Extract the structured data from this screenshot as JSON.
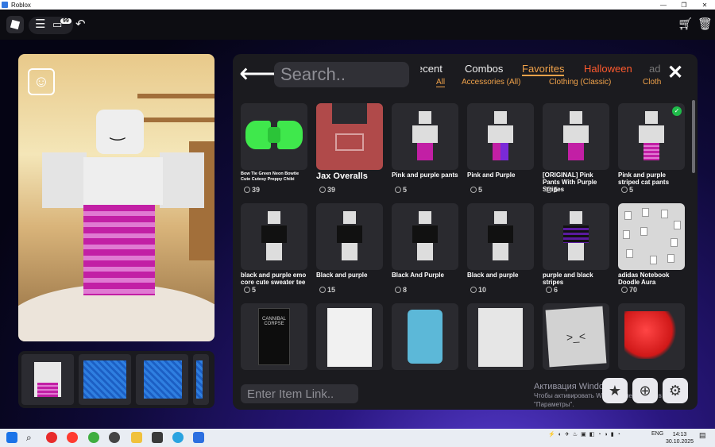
{
  "window": {
    "title": "Roblox",
    "controls": [
      "—",
      "❐",
      "✕"
    ]
  },
  "topbar": {
    "chat_badge": "99"
  },
  "catalog": {
    "search": {
      "placeholder": "Search.."
    },
    "tabs": [
      "ecent",
      "Combos",
      "Favorites",
      "Halloween",
      "ad"
    ],
    "active_tab": "Favorites",
    "subtabs": [
      "All",
      "Accessories (All)",
      "Clothing (Classic)",
      "Cloth"
    ],
    "active_subtab": "All",
    "link_input": {
      "placeholder": "Enter Item Link.."
    },
    "items": [
      {
        "name": "Bow Tie Green Neon Bowtie Cute Cutesy Preppy Chibi",
        "price": "39",
        "thumb": "bow"
      },
      {
        "name": "Jax Overalls",
        "price": "39",
        "thumb": "overall"
      },
      {
        "name": "Pink and purple pants",
        "price": "5",
        "thumb": "pink"
      },
      {
        "name": "Pink and Purple",
        "price": "5",
        "thumb": "pp"
      },
      {
        "name": "[ORIGINAL] Pink Pants With Purple Stripes",
        "price": "5",
        "thumb": "pink"
      },
      {
        "name": "Pink and purple striped cat pants",
        "price": "5",
        "thumb": "stripe",
        "owned": true
      },
      {
        "name": "black and purple emo core cute sweater tee",
        "price": "5",
        "thumb": "black"
      },
      {
        "name": "Black and purple",
        "price": "15",
        "thumb": "black"
      },
      {
        "name": "Black And Purple",
        "price": "8",
        "thumb": "black"
      },
      {
        "name": "Black and purple",
        "price": "10",
        "thumb": "black"
      },
      {
        "name": "purple and black stripes",
        "price": "6",
        "thumb": "purstripe"
      },
      {
        "name": "adidas Notebook Doodle Aura",
        "price": "70",
        "thumb": "notes"
      },
      {
        "name": "",
        "price": "",
        "thumb": "book",
        "thumb_text": "CANNIBAL CORPSE"
      },
      {
        "name": "",
        "price": "",
        "thumb": "sketch"
      },
      {
        "name": "",
        "price": "",
        "thumb": "blue"
      },
      {
        "name": "",
        "price": "",
        "thumb": "sketch2"
      },
      {
        "name": "",
        "price": "",
        "thumb": "paper",
        "thumb_text": ">_<"
      },
      {
        "name": "",
        "price": "",
        "thumb": "hair"
      }
    ]
  },
  "activation": {
    "line1": "Активация Windows",
    "line2": "Чтобы активировать Windows, перейдите в раздел",
    "line3": "\"Параметры\"."
  },
  "taskbar": {
    "lang": "ENG",
    "time": "14:13",
    "date": "30.10.2025"
  },
  "colors": {
    "accent_tab": "#f0a24a",
    "halloween": "#ff5a2e",
    "owned": "#1fbb4a"
  },
  "icons": [
    "roblox-logo-icon",
    "menu-icon",
    "chat-icon",
    "undo-icon",
    "cart-icon",
    "trash-icon",
    "face-frame-icon",
    "back-arrow-icon",
    "close-icon",
    "star-icon",
    "zoom-icon",
    "settings-icon"
  ]
}
